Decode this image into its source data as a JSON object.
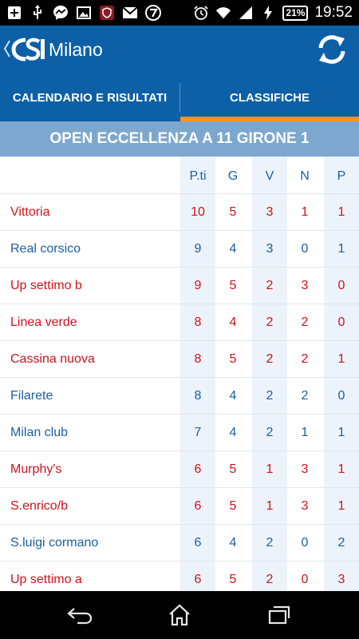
{
  "status_bar": {
    "time": "19:52",
    "battery": "21%",
    "left_icons": [
      "add-icon",
      "usb-icon",
      "messenger-icon",
      "image-icon",
      "app-shield-icon",
      "gmail-icon",
      "seven-icon"
    ],
    "right_icons": [
      "alarm-icon",
      "wifi-icon",
      "signal-icon",
      "charging-icon"
    ]
  },
  "app_bar": {
    "title": "Milano",
    "logo_icon": "csi-logo-icon",
    "refresh_icon": "refresh-icon",
    "background": "#0d5fa6"
  },
  "tabs": [
    {
      "label": "CALENDARIO E RISULTATI",
      "selected": false
    },
    {
      "label": "CLASSIFICHE",
      "selected": true
    }
  ],
  "tab_indicator_color": "#f7941d",
  "group": {
    "title": "OPEN ECCELLENZA A 11 GIRONE 1",
    "background": "#7da7cf"
  },
  "standings": {
    "columns": [
      "P.ti",
      "G",
      "V",
      "N",
      "P"
    ],
    "colors": {
      "red": "#d0121b",
      "blue": "#1b5fa3"
    },
    "rows": [
      {
        "team": "Vittoria",
        "pts": "10",
        "g": "5",
        "v": "3",
        "n": "1",
        "p": "1",
        "color": "red"
      },
      {
        "team": "Real corsico",
        "pts": "9",
        "g": "4",
        "v": "3",
        "n": "0",
        "p": "1",
        "color": "blue"
      },
      {
        "team": "Up settimo b",
        "pts": "9",
        "g": "5",
        "v": "2",
        "n": "3",
        "p": "0",
        "color": "red"
      },
      {
        "team": "Linea verde",
        "pts": "8",
        "g": "4",
        "v": "2",
        "n": "2",
        "p": "0",
        "color": "red"
      },
      {
        "team": "Cassina nuova",
        "pts": "8",
        "g": "5",
        "v": "2",
        "n": "2",
        "p": "1",
        "color": "red"
      },
      {
        "team": "Filarete",
        "pts": "8",
        "g": "4",
        "v": "2",
        "n": "2",
        "p": "0",
        "color": "blue"
      },
      {
        "team": "Milan club",
        "pts": "7",
        "g": "4",
        "v": "2",
        "n": "1",
        "p": "1",
        "color": "blue"
      },
      {
        "team": "Murphy's",
        "pts": "6",
        "g": "5",
        "v": "1",
        "n": "3",
        "p": "1",
        "color": "red"
      },
      {
        "team": "S.enrico/b",
        "pts": "6",
        "g": "5",
        "v": "1",
        "n": "3",
        "p": "1",
        "color": "red"
      },
      {
        "team": "S.luigi cormano",
        "pts": "6",
        "g": "4",
        "v": "2",
        "n": "0",
        "p": "2",
        "color": "blue"
      },
      {
        "team": "Up settimo a",
        "pts": "6",
        "g": "5",
        "v": "2",
        "n": "0",
        "p": "3",
        "color": "red"
      }
    ]
  },
  "nav_bar": {
    "buttons": [
      "back-icon",
      "home-icon",
      "recents-icon"
    ]
  }
}
